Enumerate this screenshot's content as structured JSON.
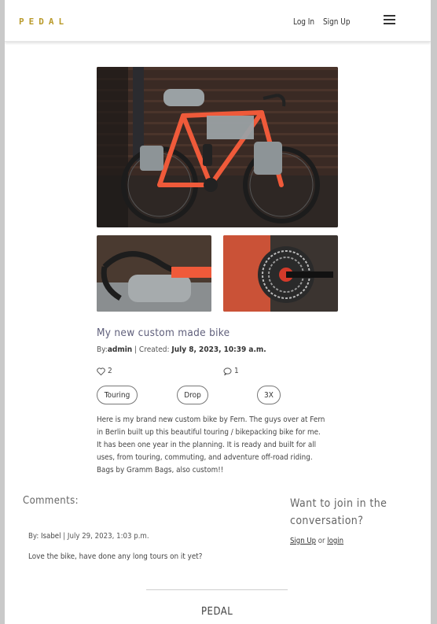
{
  "nav": {
    "brand": "PEDAL",
    "login_label": "Log In",
    "signup_label": "Sign Up",
    "menu_icon": "hamburger-menu-icon"
  },
  "post": {
    "title": "My new custom made bike",
    "by_label": "By:",
    "author": "admin",
    "created_label": "| Created:",
    "created": "July 8, 2023, 10:39 a.m.",
    "likes": "2",
    "comments": "1",
    "tags": [
      "Touring",
      "Drop",
      "3X"
    ],
    "description": "Here is my brand new custom bike by Fern. The guys over at Fern in Berlin built up this beautiful touring / bikepacking bike for me. It has been one year in the planning. It is ready and built for all uses, from touring, commuting, and adventure off-road riding. Bags by Gramm Bags, also custom!!"
  },
  "comments": {
    "heading": "Comments:",
    "items": [
      {
        "by_label": "By:",
        "author": "Isabel",
        "date": "| July 29, 2023, 1:03 p.m.",
        "text": "Love the bike, have done any long tours on it yet?"
      }
    ]
  },
  "join": {
    "heading": "Want to join in the conversation?",
    "signup_label": "Sign Up",
    "or_label": "or",
    "login_label": "login"
  },
  "footer": {
    "brand": "PEDAL"
  },
  "colors": {
    "brand": "#b99a2a",
    "bike_frame": "#ef5a3a",
    "bags": "#9aa1a4"
  }
}
